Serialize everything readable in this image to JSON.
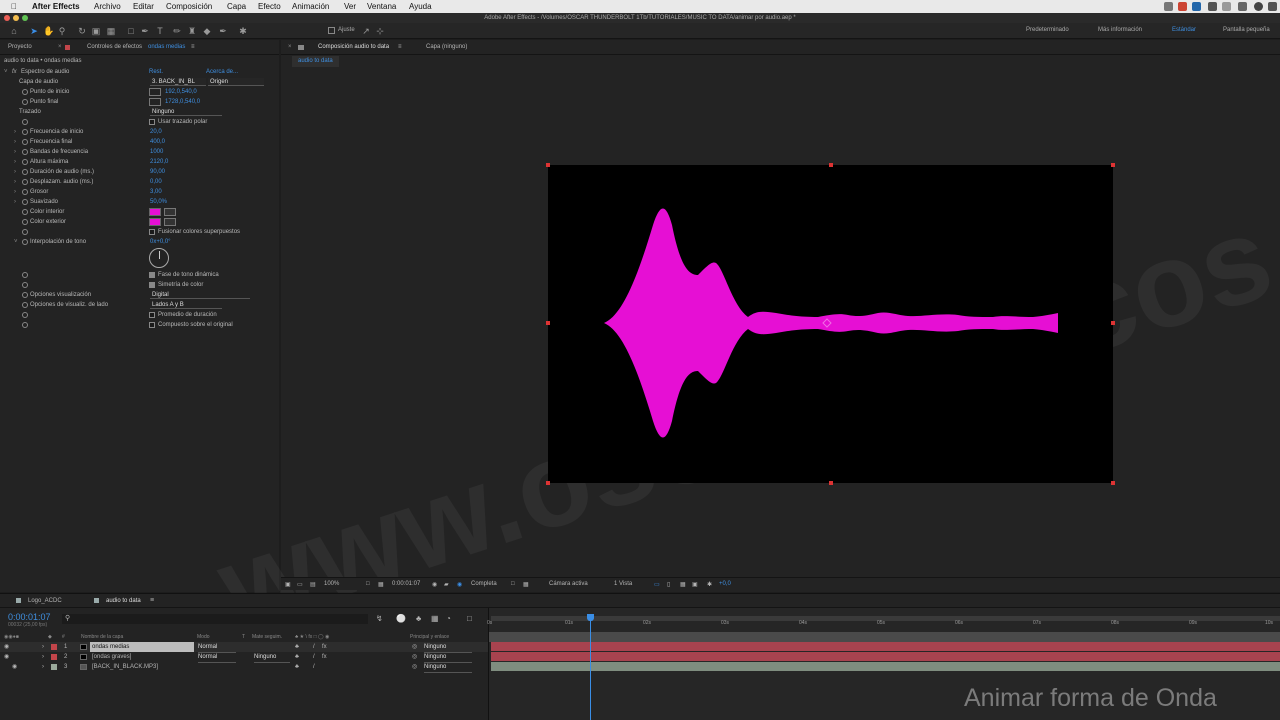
{
  "menubar": {
    "app": "After Effects",
    "items": [
      "Archivo",
      "Editar",
      "Composición",
      "Capa",
      "Efecto",
      "Animación",
      "Ver",
      "Ventana",
      "Ayuda"
    ]
  },
  "titlebar": {
    "title": "Adobe After Effects - /Volumes/OSCAR THUNDERBOLT 1Tb/TUTORIALES/MUSIC TO DATA/animar por audio.aep *"
  },
  "toolbar": {
    "snap_label": "Ajuste",
    "workspaces": [
      "Predeterminado",
      "Más información",
      "Estándar",
      "Pantalla pequeña"
    ],
    "active_workspace": "Estándar"
  },
  "left_panel": {
    "tab_project": "Proyecto",
    "tab_effects_prefix": "Controles de efectos",
    "tab_effects_layer": "ondas medias",
    "breadcrumb": "audio to data • ondas medias",
    "effect_name": "Espectro de audio",
    "reset": "Rest.",
    "about": "Acerca de...",
    "rows": [
      {
        "label": "Capa de audio",
        "dd1": "3. BACK_IN_BL",
        "dd2": "Origen"
      },
      {
        "label": "Punto de inicio",
        "value": "192,0,540,0"
      },
      {
        "label": "Punto final",
        "value": "1728,0,540,0"
      },
      {
        "label": "Trazado",
        "dd1": "Ninguno"
      },
      {
        "check": "Usar trazado polar",
        "checked": false
      },
      {
        "label": "Frecuencia de inicio",
        "value": "20,0"
      },
      {
        "label": "Frecuencia final",
        "value": "400,0"
      },
      {
        "label": "Bandas de frecuencia",
        "value": "1000"
      },
      {
        "label": "Altura máxima",
        "value": "2120,0"
      },
      {
        "label": "Duración de audio (ms.)",
        "value": "90,00"
      },
      {
        "label": "Desplazam. audio (ms.)",
        "value": "0,00"
      },
      {
        "label": "Grosor",
        "value": "3,00"
      },
      {
        "label": "Suavizado",
        "value": "50,0%"
      },
      {
        "label": "Color interior"
      },
      {
        "label": "Color exterior"
      },
      {
        "check": "Fusionar colores superpuestos",
        "checked": false
      },
      {
        "label": "Interpolación de tono",
        "value": "0x+0,0°"
      }
    ],
    "rows2": [
      {
        "check": "Fase de tono dinámica",
        "checked": true
      },
      {
        "check": "Simetría de color",
        "checked": true
      },
      {
        "label": "Opciones visualización",
        "dd1": "Digital"
      },
      {
        "label": "Opciones de visualiz. de lado",
        "dd1": "Lados A y B"
      },
      {
        "check": "Promedio de duración",
        "checked": false
      },
      {
        "check": "Compuesto sobre el original",
        "checked": false
      }
    ],
    "colors": {
      "interior": "#e60fd4",
      "exterior": "#e60fd4"
    }
  },
  "comp_panel": {
    "tab": "Composición audio to data",
    "layer_tab": "Capa (ninguno)",
    "sub_tab": "audio to data",
    "wave_color": "#e60fd4",
    "footer": {
      "zoom": "100%",
      "timecode": "0:00:01:07",
      "resolution": "Completa",
      "camera": "Cámara activa",
      "views": "1 Vista",
      "exposure": "+0,0"
    }
  },
  "timeline": {
    "tabs": [
      "Logo_ACDC",
      "audio to data"
    ],
    "active_tab": "audio to data",
    "timecode": "0:00:01:07",
    "fps": "00032 (25,00 fps)",
    "columns": {
      "name": "Nombre de la capa",
      "mode": "Modo",
      "t": "T",
      "matte": "Mate seguim.",
      "parent": "Principal y enlace"
    },
    "layers": [
      {
        "num": "1",
        "name": "ondas medias",
        "mode": "Normal",
        "matte": "",
        "parent": "Ninguno",
        "color": "#c2454a"
      },
      {
        "num": "2",
        "name": "[ondas graves]",
        "mode": "Normal",
        "matte": "Ninguno",
        "parent": "Ninguno",
        "color": "#c2454a"
      },
      {
        "num": "3",
        "name": "[BACK_IN_BLACK.MP3]",
        "mode": "",
        "matte": "",
        "parent": "Ninguno",
        "color": "#9aa89a"
      }
    ],
    "ruler": [
      "0s",
      "01s",
      "02s",
      "03s",
      "04s",
      "05s",
      "06s",
      "07s",
      "08s",
      "09s",
      "10s"
    ],
    "playhead_time": "01s07f"
  },
  "watermark": "Animar forma de Onda",
  "bg_watermark": "www.oscarodrecos.com"
}
